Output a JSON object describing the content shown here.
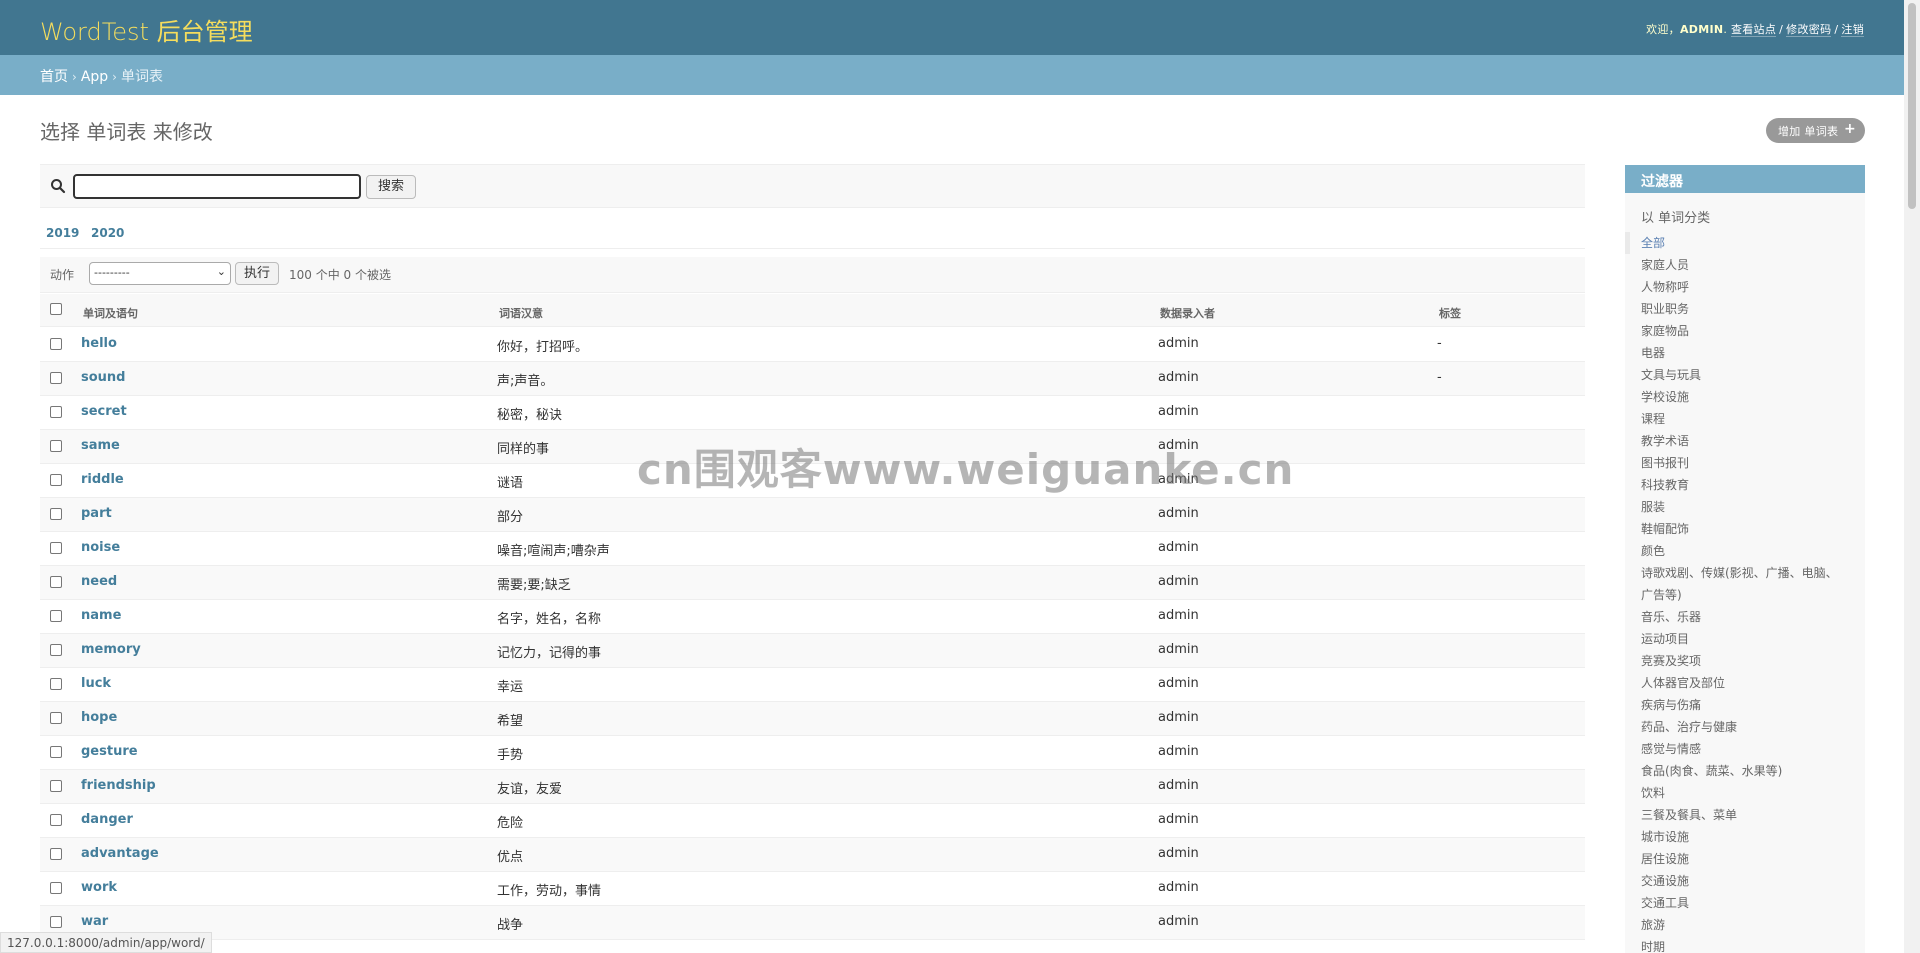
{
  "header": {
    "brand": "WordTest 后台管理",
    "welcome": "欢迎，",
    "username": "ADMIN",
    "view_site": "查看站点",
    "change_password": "修改密码",
    "logout": "注销"
  },
  "breadcrumbs": {
    "home": "首页",
    "app": "App",
    "current": "单词表"
  },
  "page": {
    "title": "选择 单词表 来修改",
    "add_button": "增加 单词表"
  },
  "search": {
    "value": "",
    "button": "搜索"
  },
  "date_hierarchy": [
    "2019",
    "2020"
  ],
  "actions": {
    "label": "动作",
    "selected": "---------",
    "go": "执行",
    "counter": "100 个中 0 个被选"
  },
  "table": {
    "columns": [
      "单词及语句",
      "词语汉意",
      "数据录入者",
      "标签"
    ],
    "rows": [
      {
        "word": "hello",
        "meaning": "你好，打招呼。",
        "author": "admin",
        "tag": "-"
      },
      {
        "word": "sound",
        "meaning": "声;声音。",
        "author": "admin",
        "tag": "-"
      },
      {
        "word": "secret",
        "meaning": "秘密，秘诀",
        "author": "admin",
        "tag": ""
      },
      {
        "word": "same",
        "meaning": "同样的事",
        "author": "admin",
        "tag": ""
      },
      {
        "word": "riddle",
        "meaning": "谜语",
        "author": "admin",
        "tag": ""
      },
      {
        "word": "part",
        "meaning": "部分",
        "author": "admin",
        "tag": ""
      },
      {
        "word": "noise",
        "meaning": "噪音;喧闹声;嘈杂声",
        "author": "admin",
        "tag": ""
      },
      {
        "word": "need",
        "meaning": "需要;要;缺乏",
        "author": "admin",
        "tag": ""
      },
      {
        "word": "name",
        "meaning": "名字，姓名，名称",
        "author": "admin",
        "tag": ""
      },
      {
        "word": "memory",
        "meaning": "记忆力，记得的事",
        "author": "admin",
        "tag": ""
      },
      {
        "word": "luck",
        "meaning": "幸运",
        "author": "admin",
        "tag": ""
      },
      {
        "word": "hope",
        "meaning": "希望",
        "author": "admin",
        "tag": ""
      },
      {
        "word": "gesture",
        "meaning": "手势",
        "author": "admin",
        "tag": ""
      },
      {
        "word": "friendship",
        "meaning": "友谊，友爱",
        "author": "admin",
        "tag": ""
      },
      {
        "word": "danger",
        "meaning": "危险",
        "author": "admin",
        "tag": ""
      },
      {
        "word": "advantage",
        "meaning": "优点",
        "author": "admin",
        "tag": ""
      },
      {
        "word": "work",
        "meaning": "工作，劳动，事情",
        "author": "admin",
        "tag": ""
      },
      {
        "word": "war",
        "meaning": "战争",
        "author": "admin",
        "tag": ""
      }
    ]
  },
  "filter": {
    "title": "过滤器",
    "subtitle": "以 单词分类",
    "items": [
      "全部",
      "家庭人员",
      "人物称呼",
      "职业职务",
      "家庭物品",
      "电器",
      "文具与玩具",
      "学校设施",
      "课程",
      "教学术语",
      "图书报刊",
      "科技教育",
      "服装",
      "鞋帽配饰",
      "颜色",
      "诗歌戏剧、传媒(影视、广播、电脑、广告等)",
      "音乐、乐器",
      "运动项目",
      "竞赛及奖项",
      "人体器官及部位",
      "疾病与伤痛",
      "药品、治疗与健康",
      "感觉与情感",
      "食品(肉食、蔬菜、水果等)",
      "饮料",
      "三餐及餐具、菜单",
      "城市设施",
      "居住设施",
      "交通设施",
      "交通工具",
      "旅游",
      "时期"
    ]
  },
  "watermark": "cn围观客www.weiguanke.cn",
  "statusbar": "127.0.0.1:8000/admin/app/word/",
  "colors": {
    "header_bg": "#417690",
    "brand": "#f5dd5d",
    "breadcrumb_bg": "#79aec8",
    "link": "#447e9b"
  }
}
